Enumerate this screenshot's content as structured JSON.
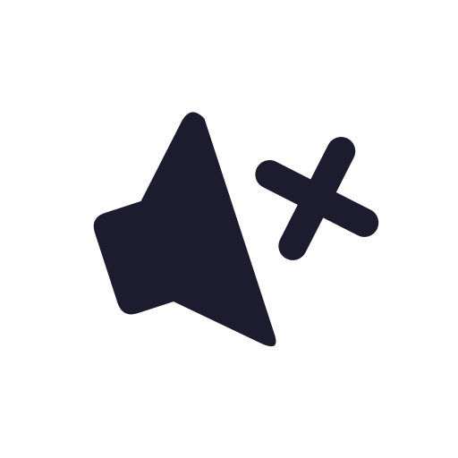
{
  "icon": {
    "name": "volume-mute",
    "color": "#1C1C2E",
    "background": "#FFFFFF"
  }
}
